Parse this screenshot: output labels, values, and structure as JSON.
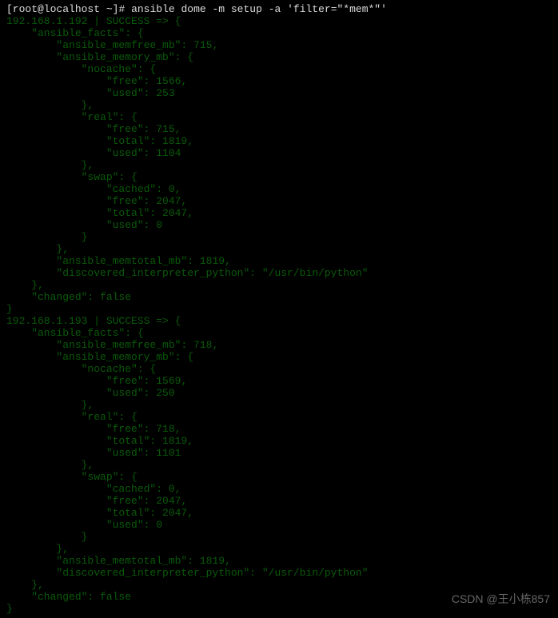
{
  "prompt": "[root@localhost ~]",
  "hash": "#",
  "command": "ansible dome -m setup -a 'filter=\"*mem*\"'",
  "results": [
    {
      "host": "192.168.1.192",
      "status": "SUCCESS",
      "arrow": "=>",
      "data": {
        "ansible_facts": {
          "ansible_memfree_mb": 715,
          "ansible_memory_mb": {
            "nocache": {
              "free": 1566,
              "used": 253
            },
            "real": {
              "free": 715,
              "total": 1819,
              "used": 1104
            },
            "swap": {
              "cached": 0,
              "free": 2047,
              "total": 2047,
              "used": 0
            }
          },
          "ansible_memtotal_mb": 1819,
          "discovered_interpreter_python": "/usr/bin/python"
        },
        "changed": false
      }
    },
    {
      "host": "192.168.1.193",
      "status": "SUCCESS",
      "arrow": "=>",
      "data": {
        "ansible_facts": {
          "ansible_memfree_mb": 718,
          "ansible_memory_mb": {
            "nocache": {
              "free": 1569,
              "used": 250
            },
            "real": {
              "free": 718,
              "total": 1819,
              "used": 1101
            },
            "swap": {
              "cached": 0,
              "free": 2047,
              "total": 2047,
              "used": 0
            }
          },
          "ansible_memtotal_mb": 1819,
          "discovered_interpreter_python": "/usr/bin/python"
        },
        "changed": false
      }
    }
  ],
  "watermark": "CSDN @王小栋857"
}
